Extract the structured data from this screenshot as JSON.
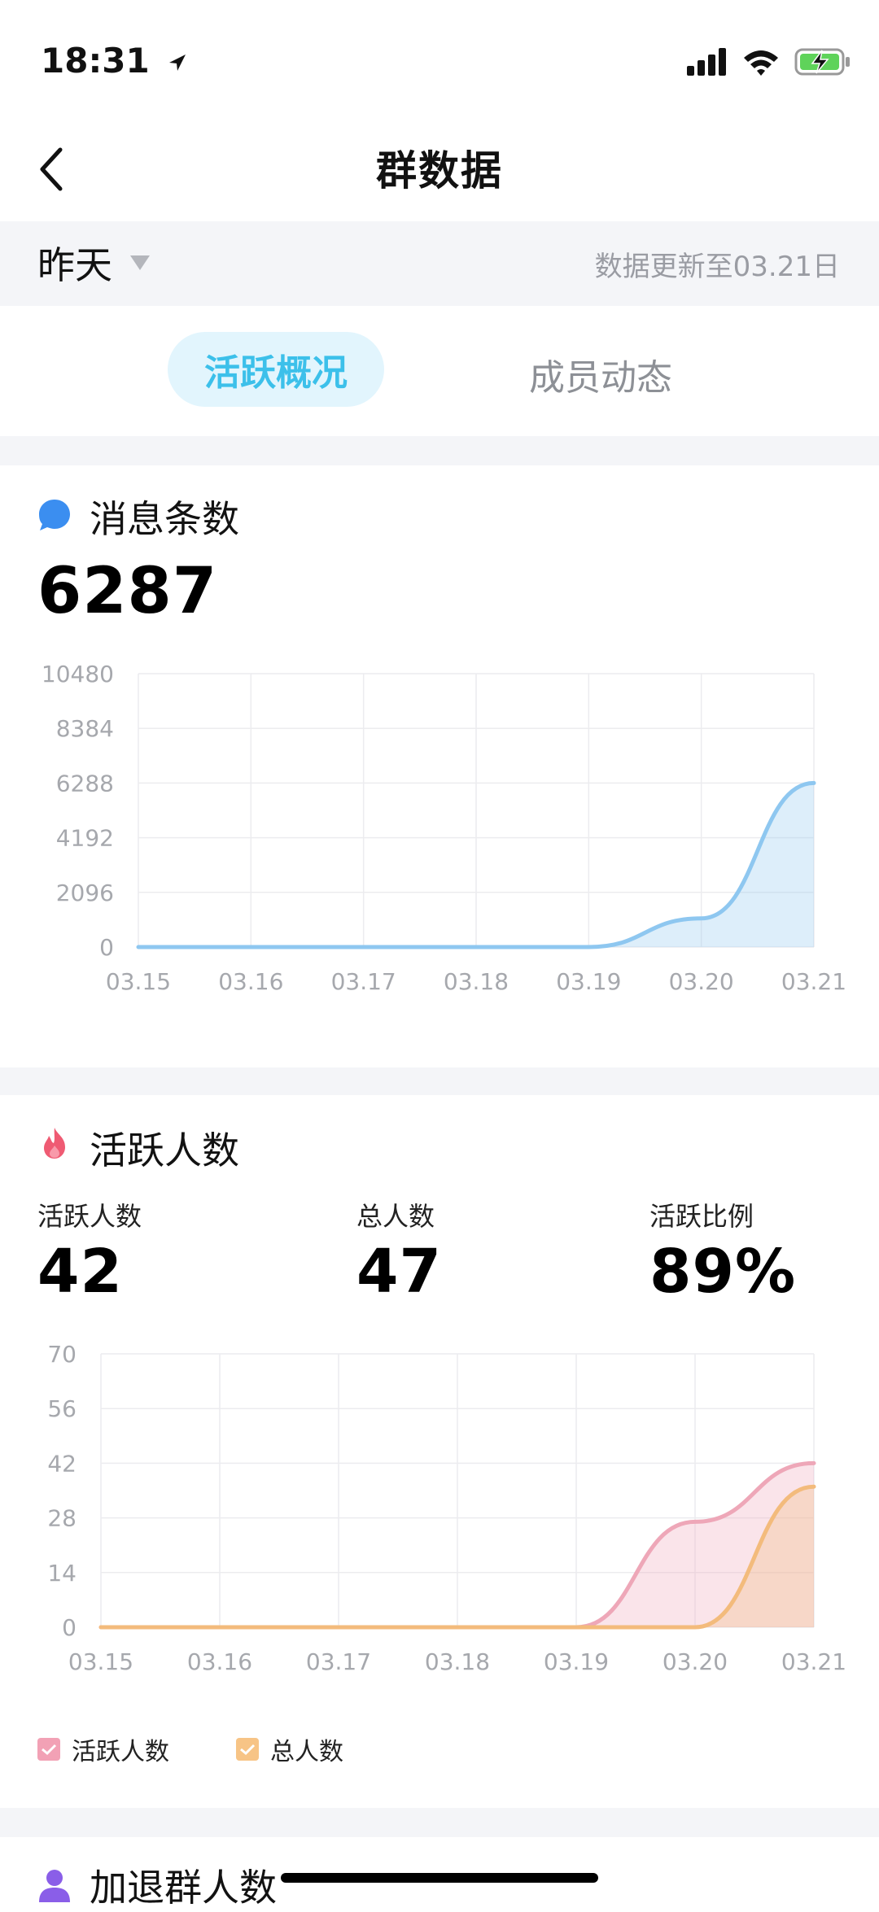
{
  "status": {
    "time": "18:31"
  },
  "header": {
    "title": "群数据"
  },
  "date_bar": {
    "selected": "昨天",
    "update_text": "数据更新至03.21日"
  },
  "tabs": [
    {
      "label": "活跃概况",
      "active": true
    },
    {
      "label": "成员动态",
      "active": false
    }
  ],
  "messages": {
    "title": "消息条数",
    "total": "6287",
    "icon": "chat-bubble-icon",
    "color": "#3b8ef0"
  },
  "active": {
    "title": "活跃人数",
    "icon": "fire-icon",
    "stats": [
      {
        "label": "活跃人数",
        "value": "42"
      },
      {
        "label": "总人数",
        "value": "47"
      },
      {
        "label": "活跃比例",
        "value": "89%"
      }
    ]
  },
  "legend": [
    {
      "label": "活跃人数",
      "color": "#f2a1b5"
    },
    {
      "label": "总人数",
      "color": "#f7c486"
    }
  ],
  "join_leave": {
    "title": "加退群人数",
    "icon": "person-icon"
  },
  "chart_data": [
    {
      "type": "area",
      "categories": [
        "03.15",
        "03.16",
        "03.17",
        "03.18",
        "03.19",
        "03.20",
        "03.21"
      ],
      "ylim": [
        0,
        10480
      ],
      "yticks": [
        "0",
        "2096",
        "4192",
        "6288",
        "8384",
        "10480"
      ],
      "series": [
        {
          "values": [
            0,
            0,
            0,
            0,
            0,
            1100,
            6287
          ],
          "color": "#8ec7f0"
        }
      ],
      "grid": true
    },
    {
      "type": "area",
      "categories": [
        "03.15",
        "03.16",
        "03.17",
        "03.18",
        "03.19",
        "03.20",
        "03.21"
      ],
      "ylim": [
        0,
        70
      ],
      "yticks": [
        "0",
        "14",
        "28",
        "42",
        "56",
        "70"
      ],
      "series": [
        {
          "name": "活跃人数",
          "values": [
            0,
            0,
            0,
            0,
            0,
            27,
            42
          ],
          "color": "#eea7b8"
        },
        {
          "name": "总人数",
          "values": [
            0,
            0,
            0,
            0,
            0,
            0,
            36
          ],
          "color": "#f3bb7c"
        }
      ],
      "grid": true,
      "legend": "bottom-left"
    }
  ]
}
